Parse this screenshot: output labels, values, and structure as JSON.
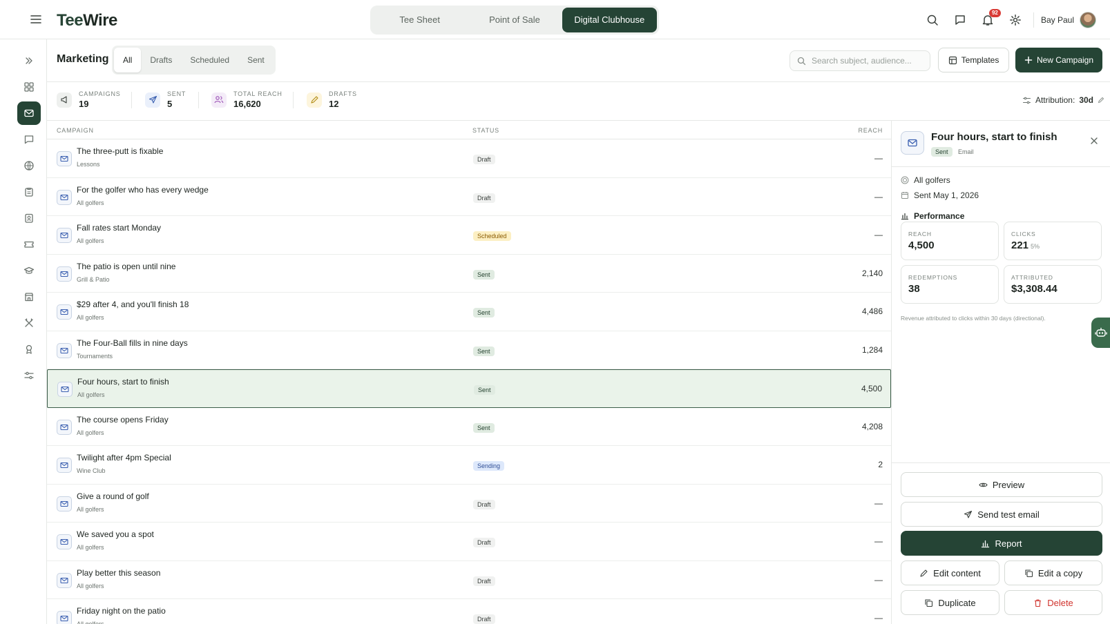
{
  "app": {
    "logo_tee": "Tee",
    "logo_wire": "Wire",
    "nav": [
      {
        "label": "Tee Sheet",
        "active": false
      },
      {
        "label": "Point of Sale",
        "active": false
      },
      {
        "label": "Digital Clubhouse",
        "active": true
      }
    ],
    "notifications_count": "92",
    "user_name": "Bay Paul"
  },
  "page": {
    "title": "Marketing",
    "tabs": [
      "All",
      "Drafts",
      "Scheduled",
      "Sent"
    ],
    "active_tab": "All",
    "search_placeholder": "Search subject, audience...",
    "templates_label": "Templates",
    "new_campaign_label": "New Campaign"
  },
  "stats": {
    "campaigns": {
      "label": "Campaigns",
      "value": "19"
    },
    "sent": {
      "label": "Sent",
      "value": "5"
    },
    "total_reach": {
      "label": "Total Reach",
      "value": "16,620"
    },
    "drafts": {
      "label": "Drafts",
      "value": "12"
    },
    "attribution_label": "Attribution:",
    "attribution_value": "30d"
  },
  "table": {
    "headers": {
      "campaign": "Campaign",
      "status": "Status",
      "reach": "Reach"
    },
    "rows": [
      {
        "title": "The three-putt is fixable",
        "audience": "Lessons",
        "status": "Draft",
        "reach": "—"
      },
      {
        "title": "For the golfer who has every wedge",
        "audience": "All golfers",
        "status": "Draft",
        "reach": "—"
      },
      {
        "title": "Fall rates start Monday",
        "audience": "All golfers",
        "status": "Scheduled",
        "reach": "—"
      },
      {
        "title": "The patio is open until nine",
        "audience": "Grill & Patio",
        "status": "Sent",
        "reach": "2,140"
      },
      {
        "title": "$29 after 4, and you'll finish 18",
        "audience": "All golfers",
        "status": "Sent",
        "reach": "4,486"
      },
      {
        "title": "The Four-Ball fills in nine days",
        "audience": "Tournaments",
        "status": "Sent",
        "reach": "1,284"
      },
      {
        "title": "Four hours, start to finish",
        "audience": "All golfers",
        "status": "Sent",
        "reach": "4,500",
        "selected": true
      },
      {
        "title": "The course opens Friday",
        "audience": "All golfers",
        "status": "Sent",
        "reach": "4,208"
      },
      {
        "title": "Twilight after 4pm Special",
        "audience": "Wine Club",
        "status": "Sending",
        "reach": "2"
      },
      {
        "title": "Give a round of golf",
        "audience": "All golfers",
        "status": "Draft",
        "reach": "—"
      },
      {
        "title": "We saved you a spot",
        "audience": "All golfers",
        "status": "Draft",
        "reach": "—"
      },
      {
        "title": "Play better this season",
        "audience": "All golfers",
        "status": "Draft",
        "reach": "—"
      },
      {
        "title": "Friday night on the patio",
        "audience": "All golfers",
        "status": "Draft",
        "reach": "—"
      }
    ]
  },
  "panel": {
    "title": "Four hours, start to finish",
    "status": "Sent",
    "type": "Email",
    "audience": "All golfers",
    "sent_date": "Sent May 1, 2026",
    "performance_label": "Performance",
    "reach": {
      "label": "Reach",
      "value": "4,500"
    },
    "clicks": {
      "label": "Clicks",
      "value": "221",
      "sub": "5%"
    },
    "redemptions": {
      "label": "Redemptions",
      "value": "38"
    },
    "attributed": {
      "label": "Attributed",
      "value": "$3,308.44"
    },
    "note": "Revenue attributed to clicks within 30 days (directional).",
    "actions": {
      "preview": "Preview",
      "send_test": "Send test email",
      "report": "Report",
      "edit_content": "Edit content",
      "edit_copy": "Edit a copy",
      "duplicate": "Duplicate",
      "delete": "Delete"
    }
  },
  "colors": {
    "brand_dark": "#254435",
    "danger": "#d0322c",
    "selected_row": "#eaf3ea"
  }
}
